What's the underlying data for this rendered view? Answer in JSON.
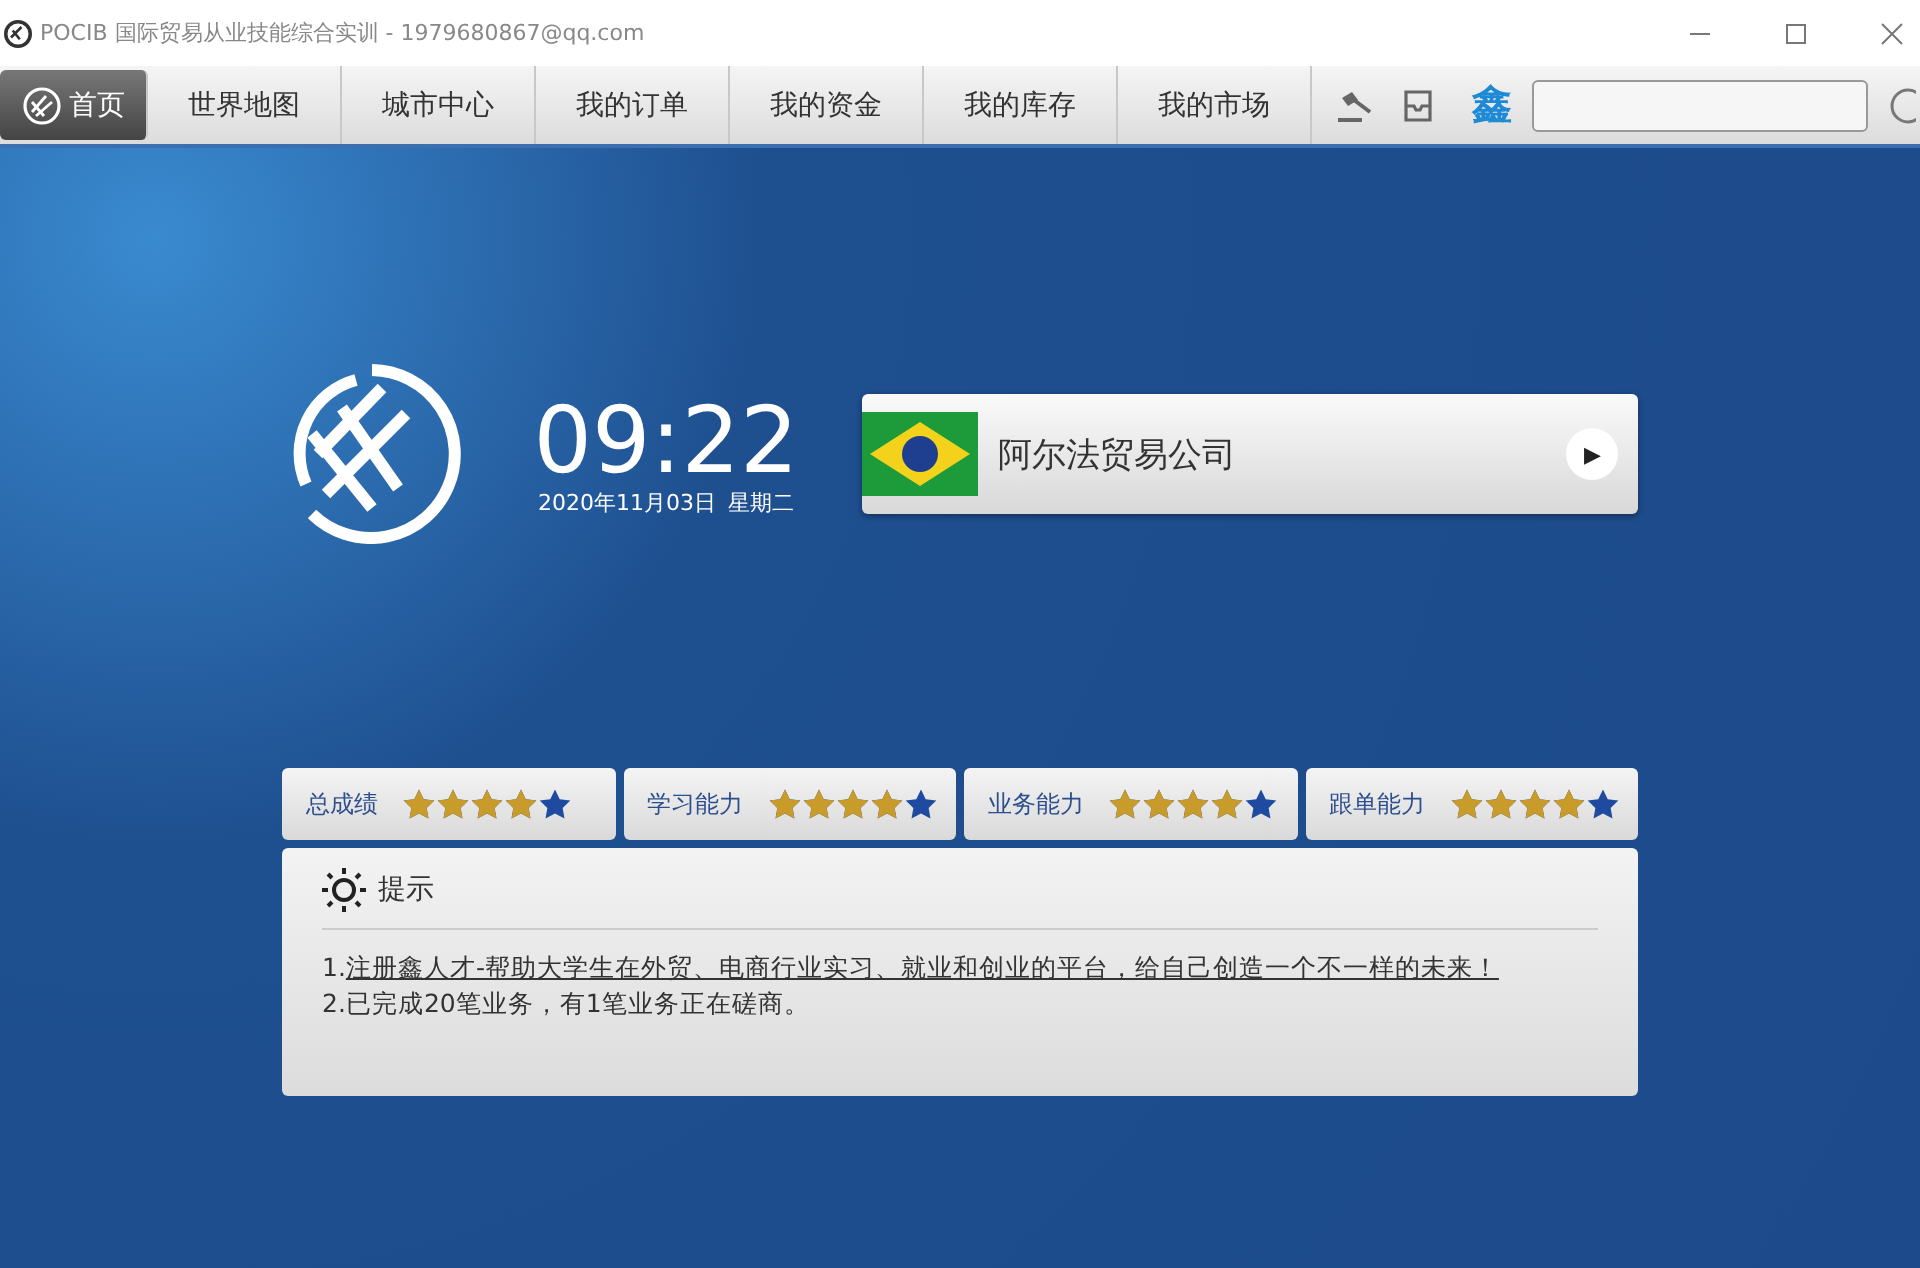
{
  "window": {
    "title": "POCIB 国际贸易从业技能综合实训 - 1979680867@qq.com"
  },
  "nav": [
    {
      "label": "首页",
      "selected": true
    },
    {
      "label": "世界地图",
      "selected": false
    },
    {
      "label": "城市中心",
      "selected": false
    },
    {
      "label": "我的订单",
      "selected": false
    },
    {
      "label": "我的资金",
      "selected": false
    },
    {
      "label": "我的库存",
      "selected": false
    },
    {
      "label": "我的市场",
      "selected": false
    }
  ],
  "brand_glyph": "鑫",
  "clock": {
    "time": "09:22",
    "date": "2020年11月03日",
    "weekday": "星期二"
  },
  "company": {
    "name": "阿尔法贸易公司",
    "play_glyph": "▶"
  },
  "ratings": [
    {
      "label": "总成绩",
      "stars": 4
    },
    {
      "label": "学习能力",
      "stars": 4
    },
    {
      "label": "业务能力",
      "stars": 4
    },
    {
      "label": "跟单能力",
      "stars": 4
    }
  ],
  "tips": {
    "title": "提示",
    "items": [
      {
        "number": "1.",
        "text": "注册鑫人才-帮助大学生在外贸、电商行业实习、就业和创业的平台，给自己创造一个不一样的未来！",
        "kind": "link"
      },
      {
        "number": "2.",
        "text": "已完成20笔业务，有1笔业务正在磋商。",
        "kind": "plain"
      }
    ]
  }
}
